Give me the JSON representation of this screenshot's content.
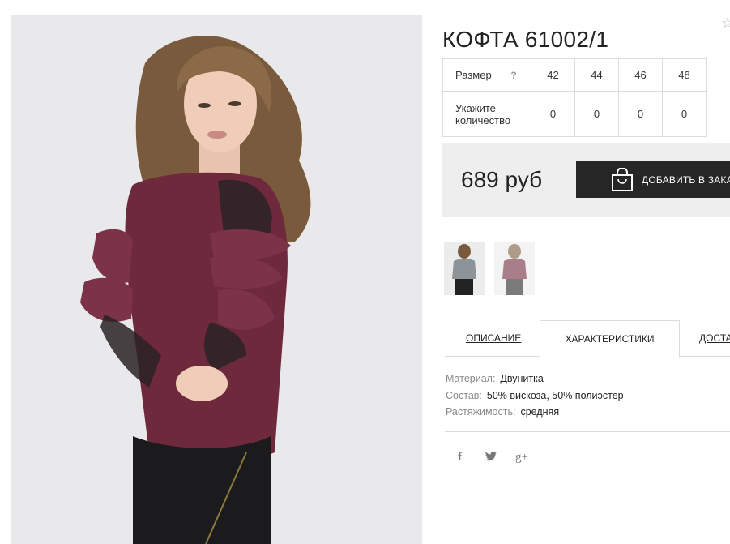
{
  "product": {
    "title": "КОФТА 61002/1",
    "favorite_icon": "star-outline-icon"
  },
  "size_table": {
    "size_label": "Размер",
    "help_mark": "?",
    "sizes": [
      "42",
      "44",
      "46",
      "48"
    ],
    "qty_label": "Укажите количество",
    "quantities": [
      "0",
      "0",
      "0",
      "0"
    ]
  },
  "price": {
    "amount": "689 руб",
    "add_button_label": "ДОБАВИТЬ В ЗАКАЗ",
    "button_icon": "shopping-bag-icon"
  },
  "tabs": [
    {
      "label": "ОПИСАНИЕ",
      "active": false
    },
    {
      "label": "ХАРАКТЕРИСТИКИ",
      "active": true
    },
    {
      "label": "ДОСТАВКА",
      "active": false
    }
  ],
  "characteristics": [
    {
      "key": "Материал:",
      "value": "Двунитка"
    },
    {
      "key": "Состав:",
      "value": "50% вискоза, 50% полиэстер"
    },
    {
      "key": "Растяжимость:",
      "value": "средняя"
    }
  ],
  "social": {
    "facebook": "f",
    "twitter": "twitter-bird-icon",
    "googleplus": "g+"
  },
  "colors": {
    "sweater": "#6e2a3c",
    "button_bg": "#262626",
    "price_bg": "#eeeeee"
  }
}
